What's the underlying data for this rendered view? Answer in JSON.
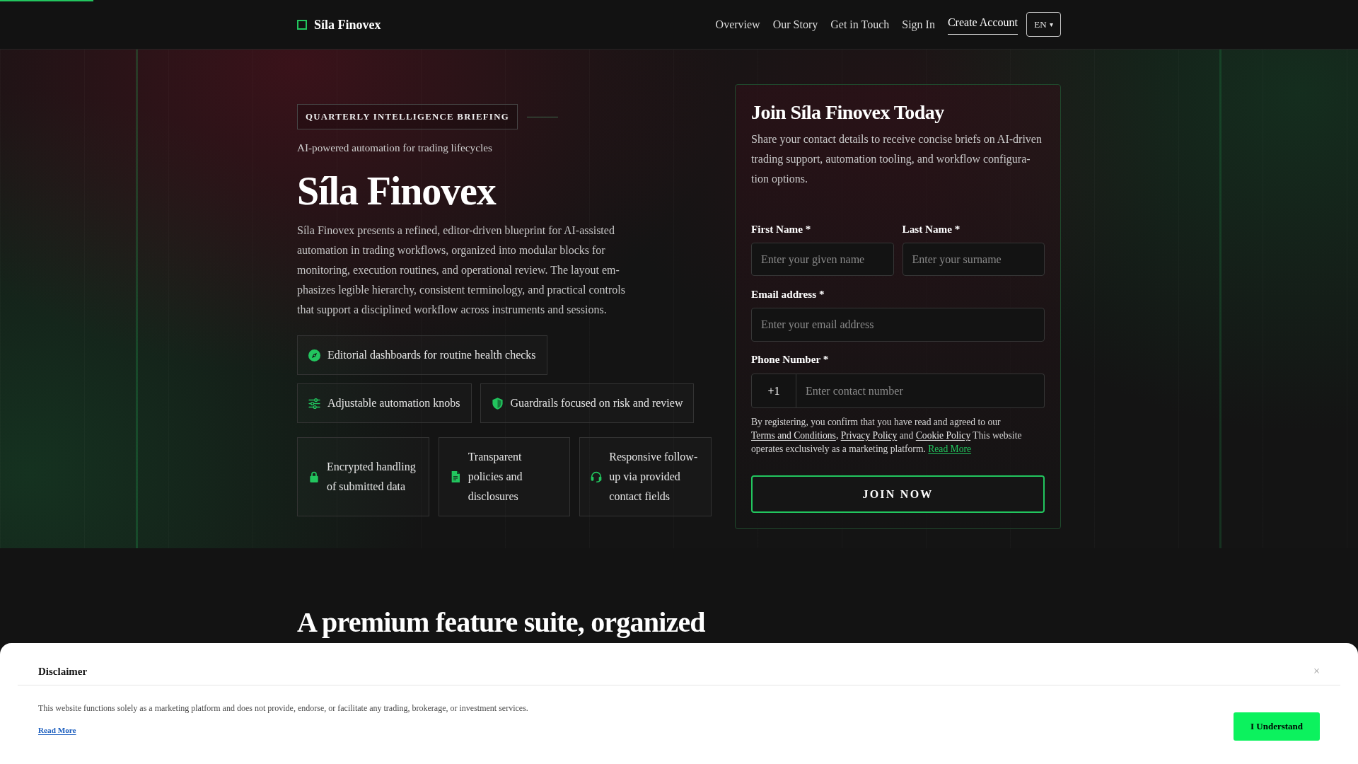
{
  "header": {
    "logo": "Síla Finovex",
    "nav": [
      {
        "label": "Overview",
        "selected": false
      },
      {
        "label": "Our Story",
        "selected": false
      },
      {
        "label": "Get in Touch",
        "selected": false
      },
      {
        "label": "Sign In",
        "selected": false
      },
      {
        "label": "Create Account",
        "selected": true
      }
    ],
    "language": {
      "label": "EN",
      "caret": "▾"
    }
  },
  "hero": {
    "badge": "QUARTERLY INTELLIGENCE BRIEFING",
    "tagline": "AI-powered automation for trading lifecycles",
    "title": "Síla Finovex",
    "description": "Síla Finovex presents a refined, editor-driven blueprint for AI-assisted automation in trading workflows, organized into modular blocks for monitoring, execution routines, and operational review. The layout em-phasizes legible hierarchy, consistent terminology, and practical controls that support a disciplined workflow across instruments and sessions.",
    "feature_groups": [
      {
        "kind": "chip",
        "items": [
          "Editorial dashboards for routine health checks"
        ]
      },
      {
        "kind": "chip",
        "items": [
          "Adjustable automation knobs",
          "Guardrails focused on risk and review"
        ]
      },
      {
        "kind": "card",
        "items": [
          "Encrypted handling of submitted data",
          "Transparent policies and disclosures",
          "Responsive follow-up via provided contact fields"
        ]
      }
    ]
  },
  "signup_form": {
    "title": "Join Síla Finovex Today",
    "description": "Share your contact details to receive concise briefs on AI-driven trading support, automation tooling, and workflow configura-tion options.",
    "name_fields": [
      {
        "label": "First Name *",
        "placeholder": "Enter your given name"
      },
      {
        "label": "Last Name *",
        "placeholder": "Enter your surname"
      }
    ],
    "email_field": {
      "label": "Email address *",
      "placeholder": "Enter your email address"
    },
    "phone_field": {
      "label": "Phone Number *",
      "prefix": "+1",
      "placeholder": "Enter contact number"
    },
    "consent": [
      {
        "kind": "text",
        "text": "By registering, you confirm that you have read and agreed to our "
      },
      {
        "kind": "link",
        "text": "Terms and Conditions"
      },
      {
        "kind": "text",
        "text": ", "
      },
      {
        "kind": "link",
        "text": "Privacy Policy"
      },
      {
        "kind": "text",
        "text": " and "
      },
      {
        "kind": "link",
        "text": "Cookie Policy"
      },
      {
        "kind": "text",
        "text": " This website operates exclusively as a marketing platform. "
      },
      {
        "kind": "accent",
        "text": "Read More"
      }
    ],
    "submit": "JOIN NOW"
  },
  "features_section": {
    "heading": "A premium feature suite, organized"
  },
  "disclaimer": {
    "title": "Disclaimer",
    "close": "×",
    "text": "This website functions solely as a marketing platform and does not provide, endorse, or facilitate any trading, brokerage, or investment services.",
    "link": "Read More",
    "button": "I Understand"
  }
}
